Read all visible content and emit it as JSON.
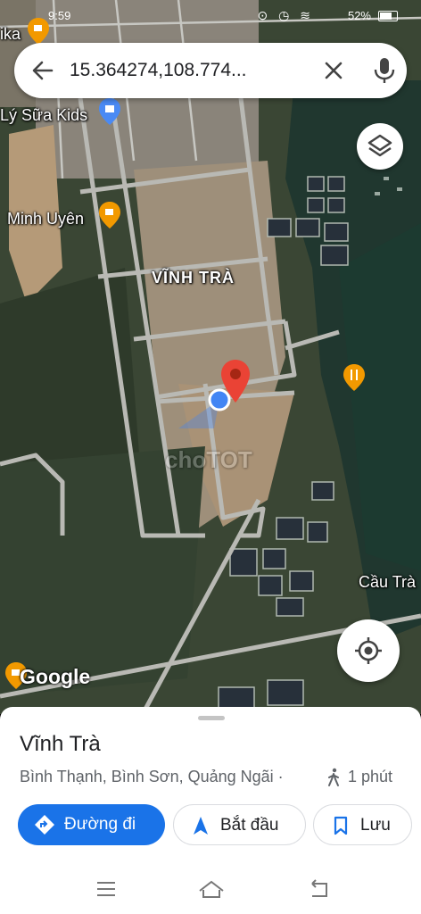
{
  "status": {
    "time": "9:59",
    "icons": "⊙ ◷ ≋",
    "battery": "52%"
  },
  "search": {
    "query": "15.364274,108.774..."
  },
  "map": {
    "labels": {
      "poi_top": "ika",
      "milk_shop": "Lý Sữa Kids",
      "cafe": "Minh Uyên",
      "area": "VĨNH TRÀ",
      "bridge": "Cầu Trà",
      "watermark": "choTOT"
    },
    "google": "Google",
    "colors": {
      "pin": "#ea4335",
      "location_dot": "#4285f4",
      "poi_orange": "#f29900",
      "poi_blue": "#4a8af4"
    }
  },
  "place": {
    "title": "Vĩnh Trà",
    "subtitle": "Bình Thạnh, Bình Sơn, Quảng Ngãi ·",
    "walk_time": "1 phút"
  },
  "actions": {
    "directions": "Đường đi",
    "start": "Bắt đầu",
    "save": "Lưu"
  },
  "nav": {
    "icons": [
      "menu-icon",
      "home-icon",
      "back-icon"
    ]
  }
}
